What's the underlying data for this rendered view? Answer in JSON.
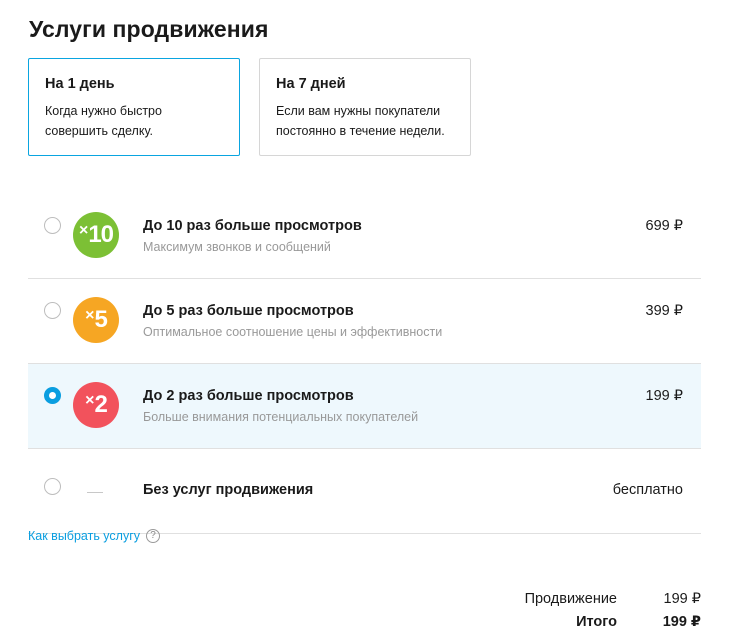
{
  "page_title": "Услуги продвижения",
  "periods": [
    {
      "title": "На 1 день",
      "desc": "Когда нужно быстро совершить сделку.",
      "active": true
    },
    {
      "title": "На 7 дней",
      "desc": "Если вам нужны покупатели постоянно в течение недели.",
      "active": false
    }
  ],
  "options": [
    {
      "badge": "10",
      "badge_prefix": "×",
      "badge_color": "#7cc035",
      "title": "До 10 раз больше просмотров",
      "sub": "Максимум звонков и сообщений",
      "price": "699 ₽",
      "selected": false
    },
    {
      "badge": "5",
      "badge_prefix": "×",
      "badge_color": "#f6a623",
      "title": "До 5 раз больше просмотров",
      "sub": "Оптимальное соотношение цены и эффективности",
      "price": "399 ₽",
      "selected": false
    },
    {
      "badge": "2",
      "badge_prefix": "×",
      "badge_color": "#f2525c",
      "title": "До 2 раз больше просмотров",
      "sub": "Больше внимания потенциальных покупателей",
      "price": "199 ₽",
      "selected": true
    },
    {
      "title": "Без услуг продвижения",
      "price": "бесплатно",
      "selected": false
    }
  ],
  "help_link": "Как выбрать услугу",
  "help_icon": "?",
  "summary": {
    "promo_label": "Продвижение",
    "promo_value": "199 ₽",
    "total_label": "Итого",
    "total_value": "199 ₽"
  },
  "colors": {
    "accent": "#0a9ee0",
    "selected_bg": "#eef8fd"
  }
}
